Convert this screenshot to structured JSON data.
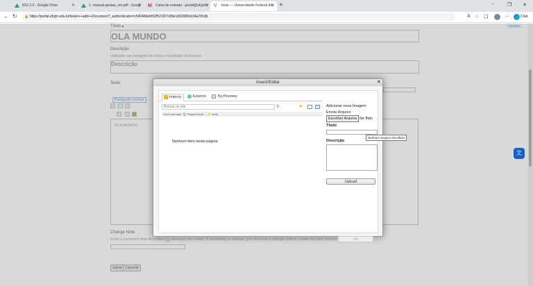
{
  "browser": {
    "tabs": [
      {
        "title": "IDG 2.0 - Google Drive",
        "favicon_color": "#1fa463"
      },
      {
        "title": "1- manual-gestao_rev.pdf - Googl",
        "favicon_color": "#1fa463"
      },
      {
        "title": "Caixa de entrada - portal@ufyjm.e",
        "favicon_color": "#d93025"
      },
      {
        "title": "teste — Universidade Federal dos",
        "favicon_color": "#6aa84f"
      }
    ],
    "new_tab": "+",
    "window_controls": [
      "−",
      "❐",
      "✕"
    ],
    "url": "https://portal.ufvjm.edu.br/teste/++add++Document?_authenticator=c54048debf92f521f07c89e1d02680cb34a781db",
    "chat_label": "Chat",
    "toolbar_icons": [
      "read-aloud-icon",
      "favorite-star-icon",
      "collections-icon",
      "profile-icon",
      "more-icon"
    ]
  },
  "form": {
    "version_label": "Versões",
    "titulo_label": "Título",
    "required_mark": "■",
    "titulo_value": "OLA MUNDO",
    "descricao_label": "Descrição",
    "descricao_help": "Utilizado nas listagens de itens e resultado de buscas",
    "descricao_placeholder": "Descrição",
    "texto_label": "Texto",
    "paragraph_style": "Parágrafo normal",
    "editor_content": "OLA MUNDO",
    "change_note_label": "Change Note",
    "change_note_help": "Enter a comment that describes the changes you made. If versioning is manual, you must set a change note to create the new version.",
    "save_button": "Salvar",
    "cancel_button": "Cancelar"
  },
  "modal": {
    "title": "Inserir/Editar",
    "close": "×",
    "tabs": [
      {
        "label": "Interno",
        "active": true
      },
      {
        "label": "Externo",
        "active": false
      },
      {
        "label": "Tip Preview",
        "active": false
      }
    ],
    "search_placeholder": "Buscar no site",
    "breadcrumb": "Você está aqui:  🏠 Página Inicial → 📁 teste",
    "empty_message": "Nenhum item nesta página",
    "add_image_heading": "Adicionar nova Imagem",
    "send_file_label": "Enviar Arquivo",
    "choose_file_button": "Escolher Arquivo",
    "file_status": "Ne    ffido",
    "no_file_tooltip": "Nenhum arquivo escolhido",
    "titulo_label": "Título",
    "descricao_label": "Descrição",
    "upload_button": "Upload",
    "footer_upload": "Upload",
    "ok_button": "Ok"
  }
}
